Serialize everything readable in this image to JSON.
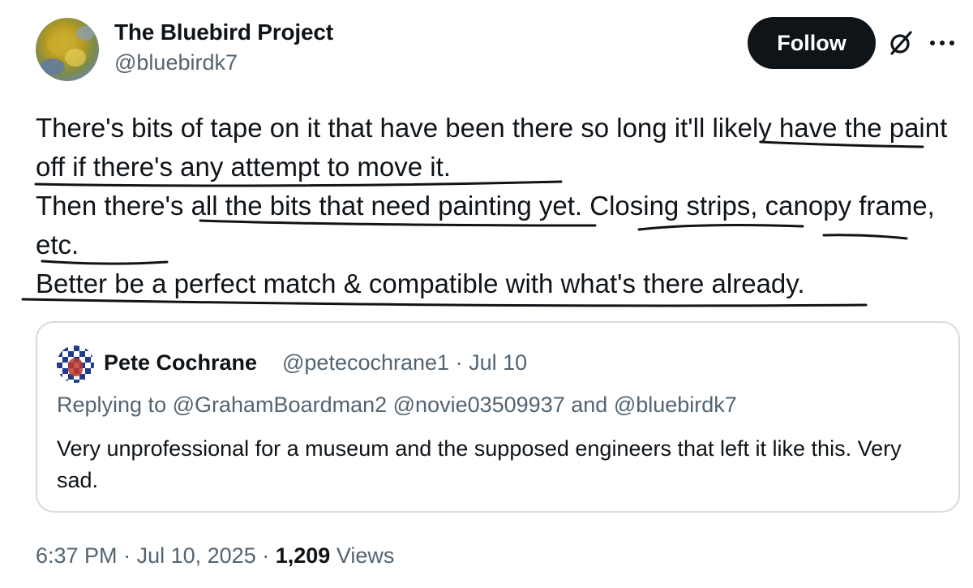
{
  "author": {
    "display_name": "The Bluebird Project",
    "handle": "@bluebirdk7"
  },
  "actions": {
    "follow_label": "Follow",
    "grok_icon": "grok-slash-icon",
    "more_icon": "more-horizontal-icon"
  },
  "tweet": {
    "lines": [
      "There's bits of tape on it that have been there so long it'll likely have the paint off if there's any attempt to move it.",
      "Then there's all the bits that need painting yet. Closing strips, canopy frame, etc.",
      "Better be a perfect match & compatible with what's there already."
    ]
  },
  "quote": {
    "name": "Pete Cochrane",
    "handle": "@petecochrane1",
    "separator": "·",
    "date": "Jul 10",
    "replying_prefix": "Replying to",
    "replying_handles": "@GrahamBoardman2 @novie03509937",
    "replying_and": "and",
    "replying_last": "@bluebirdk7",
    "text": "Very unprofessional for a museum and the supposed engineers that left it like this. Very sad."
  },
  "footer": {
    "time": "6:37 PM",
    "separator": "·",
    "date": "Jul 10, 2025",
    "views_count": "1,209",
    "views_label": "Views"
  },
  "colors": {
    "text": "#0f1419",
    "muted": "#536471",
    "border": "#d4dbe1",
    "button_bg": "#0f1419",
    "button_text": "#ffffff"
  }
}
